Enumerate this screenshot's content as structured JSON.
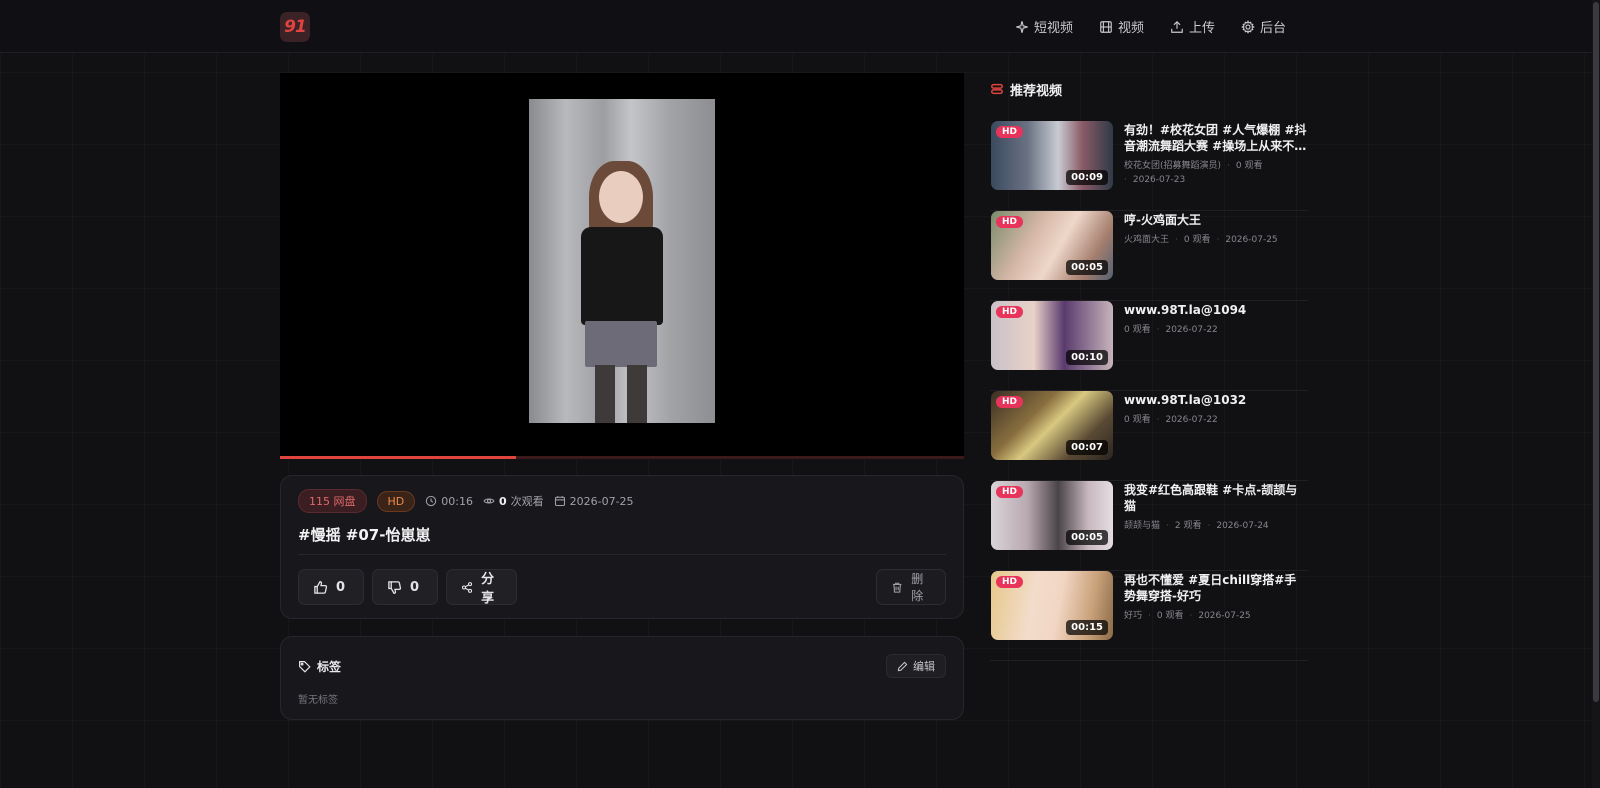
{
  "header": {
    "logo_text": "91",
    "nav": [
      {
        "label": "短视频",
        "icon": "sparkle-icon"
      },
      {
        "label": "视频",
        "icon": "film-icon"
      },
      {
        "label": "上传",
        "icon": "upload-icon"
      },
      {
        "label": "后台",
        "icon": "gear-icon"
      }
    ]
  },
  "player": {
    "progress": 0.345,
    "accent_color": "#e0443f"
  },
  "video": {
    "badge_source": "115 网盘",
    "badge_quality": "HD",
    "duration": "00:16",
    "views_count": "0",
    "views_suffix": "次观看",
    "date": "2026-07-25",
    "title": "#慢摇 #07-怡崽崽"
  },
  "actions": {
    "like_count": "0",
    "dislike_count": "0",
    "share_label": "分享",
    "delete_label": "删除"
  },
  "tags": {
    "title": "标签",
    "edit_label": "编辑",
    "empty_text": "暂无标签"
  },
  "sidebar": {
    "title": "推荐视频",
    "items": [
      {
        "hd": "HD",
        "duration": "00:09",
        "title": "有劲！#校花女团 #人气爆棚 #抖音潮流舞蹈大赛 #操场上从来不…",
        "meta_line1": "校花女团(招募舞蹈演员)",
        "views": "0 观看",
        "date": "2026-07-23"
      },
      {
        "hd": "HD",
        "duration": "00:05",
        "title": "哼-火鸡面大王",
        "author": "火鸡面大王",
        "views": "0 观看",
        "date": "2026-07-25"
      },
      {
        "hd": "HD",
        "duration": "00:10",
        "title": "www.98T.la@1094",
        "views": "0 观看",
        "date": "2026-07-22"
      },
      {
        "hd": "HD",
        "duration": "00:07",
        "title": "www.98T.la@1032",
        "views": "0 观看",
        "date": "2026-07-22"
      },
      {
        "hd": "HD",
        "duration": "00:05",
        "title": "我变#红色高跟鞋 #卡点-颉颉与猫",
        "author": "颉颉与猫",
        "views": "2 观看",
        "date": "2026-07-24"
      },
      {
        "hd": "HD",
        "duration": "00:15",
        "title": "再也不懂爱 #夏日chill穿搭#手势舞穿搭-好巧",
        "author": "好巧",
        "views": "0 观看",
        "date": "2026-07-25"
      }
    ]
  }
}
